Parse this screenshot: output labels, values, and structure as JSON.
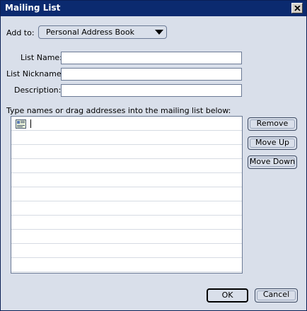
{
  "window": {
    "title": "Mailing List"
  },
  "add_to": {
    "label": "Add to:",
    "selected": "Personal Address Book"
  },
  "fields": {
    "list_name": {
      "label": "List Name:",
      "value": ""
    },
    "list_nickname": {
      "label": "List Nickname:",
      "value": ""
    },
    "description": {
      "label": "Description:",
      "value": ""
    }
  },
  "instructions": "Type names or drag addresses into the mailing list below:",
  "list": {
    "rows": 11,
    "icon": "address-card-icon"
  },
  "buttons": {
    "remove": "Remove",
    "move_up": "Move Up",
    "move_down": "Move Down",
    "ok": "OK",
    "cancel": "Cancel"
  }
}
